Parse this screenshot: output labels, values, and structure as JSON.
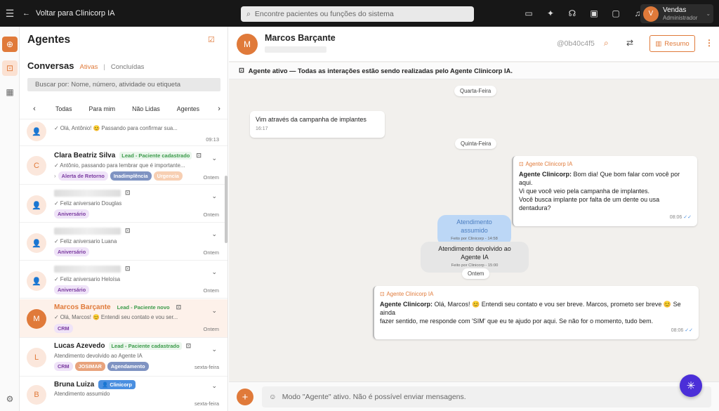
{
  "topbar": {
    "back_label": "Voltar para Clinicorp IA",
    "search_placeholder": "Encontre pacientes ou funções do sistema",
    "user_initial": "V",
    "user_name": "Vendas",
    "user_role": "Administrador"
  },
  "left": {
    "title": "Agentes",
    "conversas_label": "Conversas",
    "tab_active": "Ativas",
    "tab_separator": "|",
    "tab_done": "Concluídas",
    "search_placeholder": "Buscar por: Nome, número, atividade ou etiqueta",
    "filters": [
      "Todas",
      "Para mim",
      "Não Lidas",
      "Agentes"
    ]
  },
  "conversations": [
    {
      "initial": "",
      "name": "",
      "msg": "Olá, Antônio! 😊 Passando para confirmar sua...",
      "time": "09:13",
      "tags": []
    },
    {
      "initial": "C",
      "name": "Clara Beatriz Silva",
      "lead": "Lead - Paciente cadastrado",
      "msg": "Antônio, passando para lembrar que é importante...",
      "time": "Ontem",
      "tags": [
        {
          "label": "Alerta de Retorno",
          "style": "purple"
        },
        {
          "label": "Inadimplência",
          "style": "blue"
        },
        {
          "label": "Urgencia",
          "style": "peach"
        }
      ]
    },
    {
      "initial": "",
      "name": "",
      "msg": "Feliz aniversario Douglas",
      "time": "Ontem",
      "tags": [
        {
          "label": "Aniversário",
          "style": "purple"
        }
      ]
    },
    {
      "initial": "",
      "name": "",
      "msg": "Feliz aniversario Luana",
      "time": "Ontem",
      "tags": [
        {
          "label": "Aniversário",
          "style": "purple"
        }
      ]
    },
    {
      "initial": "",
      "name": "",
      "msg": "Feliz aniversario Heloísa",
      "time": "Ontem",
      "tags": [
        {
          "label": "Aniversário",
          "style": "purple"
        }
      ]
    },
    {
      "initial": "M",
      "name": "Marcos Barçante",
      "lead": "Lead - Paciente novo",
      "msg": "Olá, Marcos! 😊 Entendi seu contato e vou ser...",
      "time": "Ontem",
      "tags": [
        {
          "label": "CRM",
          "style": "purple"
        }
      ]
    },
    {
      "initial": "L",
      "name": "Lucas Azevedo",
      "lead": "Lead - Paciente cadastrado",
      "msg": "Atendimento devolvido ao Agente IA",
      "time": "sexta-feira",
      "tags": [
        {
          "label": "CRM",
          "style": "purple"
        },
        {
          "label": "JOSIMAR",
          "style": "orange"
        },
        {
          "label": "Agendamento",
          "style": "blue"
        }
      ]
    },
    {
      "initial": "B",
      "name": "Bruna Luiza",
      "badge": "Clinicorp",
      "msg": "Atendimento assumido",
      "time": "sexta-feira",
      "tags": []
    }
  ],
  "chat": {
    "contact_initial": "M",
    "contact_name": "Marcos Barçante",
    "hash": "@0b40c4f5",
    "resumo_label": "Resumo",
    "banner": "Agente ativo — Todas as interações estão sendo realizadas pelo Agente Clinicorp IA.",
    "day1": "Quarta-Feira",
    "msg_in_text": "Vim através da campanha de implantes",
    "msg_in_time": "16:17",
    "day2": "Quinta-Feira",
    "agent_label": "Agente Clinicorp IA",
    "msg_out1_bold": "Agente Clinicorp:",
    "msg_out1_l1": " Bom dia! Que bom falar com você por aqui.",
    "msg_out1_l2": "Vi que você veio pela campanha de implantes.",
    "msg_out1_l3": "Você busca implante por falta de um dente ou usa dentadura?",
    "msg_out1_time": "08:06",
    "sys1_title": "Atendimento assumido",
    "sys1_sub": "Feito por Clinicorp - 14:58",
    "sys2_title": "Atendimento devolvido ao Agente IA",
    "sys2_sub": "Feito por Clinicorp - 15:00",
    "day3": "Ontem",
    "msg_out2_bold": "Agente Clinicorp:",
    "msg_out2_l1": " Olá, Marcos! 😊 Entendi seu contato e vou ser breve. Marcos, prometo ser breve 😊 Se ainda",
    "msg_out2_l2": "fazer sentido, me responde com 'SIM' que eu te ajudo por aqui. Se não for o momento, tudo bem.",
    "msg_out2_time": "08:06",
    "composer_text": "Modo \"Agente\" ativo. Não é possível enviar mensagens."
  },
  "colors": {
    "accent": "#e07a3a",
    "topbar": "#171717",
    "fab": "#4b2fd8"
  }
}
